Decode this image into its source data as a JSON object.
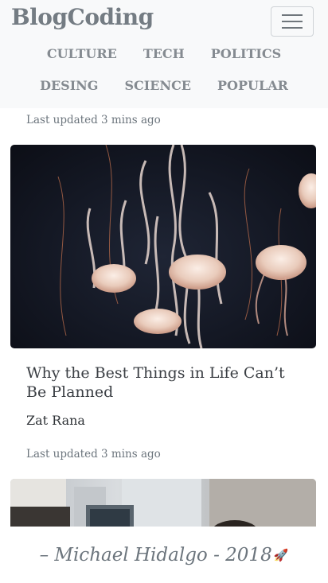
{
  "navbar": {
    "brand": "BlogCoding",
    "links_row1": [
      "CULTURE",
      "TECH",
      "POLITICS"
    ],
    "links_row2": [
      "DESING",
      "SCIENCE",
      "POPULAR"
    ]
  },
  "feed": {
    "top_meta": "Last updated 3 mins ago",
    "card": {
      "title": "Why the Best Things in Life Can’t Be Planned",
      "author": "Zat Rana",
      "meta": "Last updated 3 mins ago"
    }
  },
  "footer": {
    "text": "– Michael Hidalgo - 2018",
    "icon": "rocket-icon"
  }
}
